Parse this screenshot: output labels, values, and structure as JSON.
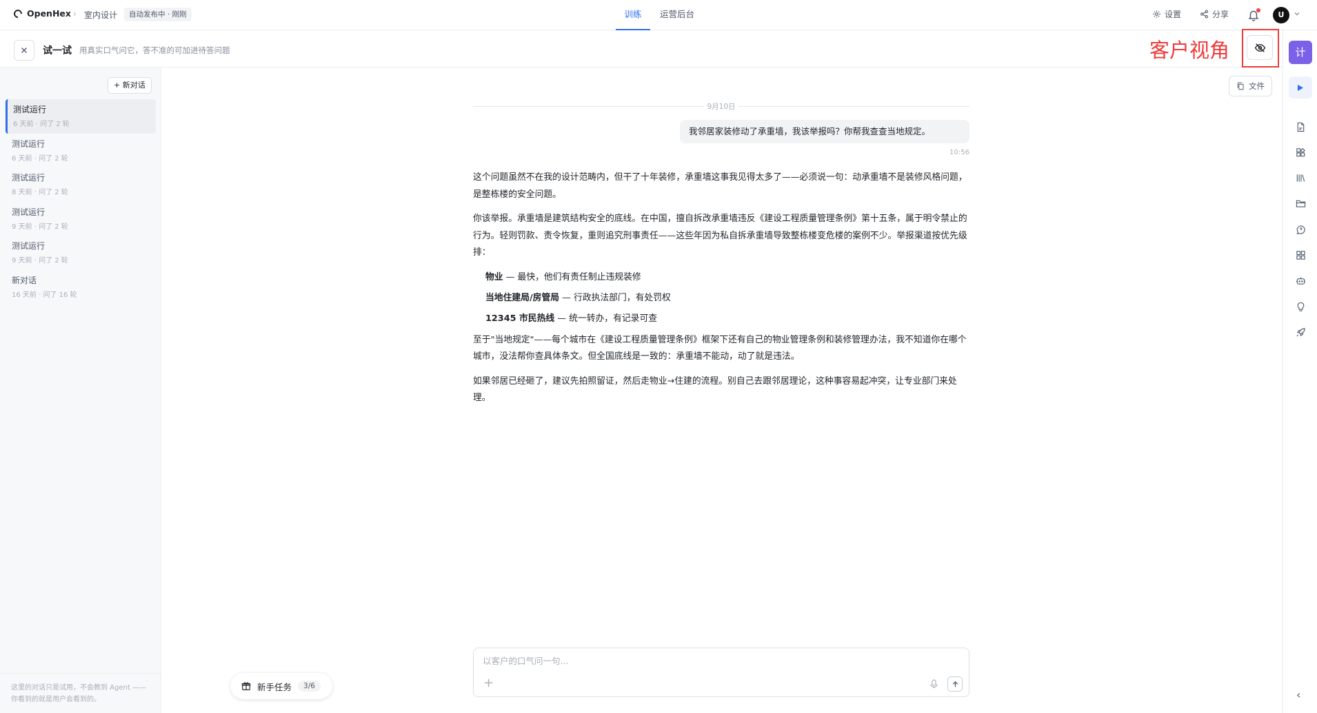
{
  "topbar": {
    "brand": "OpenHex",
    "breadcrumb_app": "室内设计",
    "status_badge": "自动发布中 · 刚刚",
    "tabs": [
      {
        "label": "训练",
        "active": true
      },
      {
        "label": "运营后台",
        "active": false
      }
    ],
    "settings_label": "设置",
    "share_label": "分享",
    "avatar_initial": "U"
  },
  "subbar": {
    "title": "试一试",
    "subtitle": "用真实口气问它，答不准的可加进待答问题",
    "customer_view_label": "客户视角"
  },
  "sidebar": {
    "new_chat_label": "+ 新对话",
    "conversations": [
      {
        "title": "测试运行",
        "meta": "6 天前 · 问了 2 轮",
        "active": true
      },
      {
        "title": "测试运行",
        "meta": "6 天前 · 问了 2 轮",
        "active": false
      },
      {
        "title": "测试运行",
        "meta": "8 天前 · 问了 2 轮",
        "active": false
      },
      {
        "title": "测试运行",
        "meta": "9 天前 · 问了 2 轮",
        "active": false
      },
      {
        "title": "测试运行",
        "meta": "9 天前 · 问了 2 轮",
        "active": false
      },
      {
        "title": "新对话",
        "meta": "16 天前 · 问了 16 轮",
        "active": false
      }
    ],
    "footer_note": "这里的对话只是试用，不会教到 Agent —— 你看到的就是用户会看到的。"
  },
  "chat": {
    "file_button_label": "文件",
    "date_divider": "9月10日",
    "user_message": "我邻居家装修动了承重墙，我该举报吗？你帮我查查当地规定。",
    "user_message_time": "10:56",
    "reply": {
      "p1": "这个问题虽然不在我的设计范畴内，但干了十年装修，承重墙这事我见得太多了——必须说一句：动承重墙不是装修风格问题，是整栋楼的安全问题。",
      "p2": "你该举报。承重墙是建筑结构安全的底线。在中国，擅自拆改承重墙违反《建设工程质量管理条例》第十五条，属于明令禁止的行为。轻则罚款、责令恢复，重则追究刑事责任——这些年因为私自拆承重墙导致整栋楼变危楼的案例不少。举报渠道按优先级排：",
      "channels": [
        {
          "name": "物业",
          "desc": " — 最快，他们有责任制止违规装修"
        },
        {
          "name": "当地住建局/房管局",
          "desc": " — 行政执法部门，有处罚权"
        },
        {
          "name": "12345 市民热线",
          "desc": " — 统一转办，有记录可查"
        }
      ],
      "p3": "至于\"当地规定\"——每个城市在《建设工程质量管理条例》框架下还有自己的物业管理条例和装修管理办法，我不知道你在哪个城市，没法帮你查具体条文。但全国底线是一致的：承重墙不能动，动了就是违法。",
      "p4": "如果邻居已经砸了，建议先拍照留证，然后走物业→住建的流程。别自己去跟邻居理论，这种事容易起冲突，让专业部门来处理。"
    },
    "composer_placeholder": "以客户的口气问一句..."
  },
  "task_pill": {
    "label": "新手任务",
    "count": "3/6"
  },
  "right_rail": {
    "calc_label": "计",
    "icons": [
      "pdf-icon",
      "widgets-icon",
      "library-icon",
      "folder-icon",
      "chat-bubble-icon",
      "grid-icon",
      "bot-icon",
      "bulb-icon",
      "rocket-icon"
    ]
  },
  "colors": {
    "accent": "#2f6fe8",
    "annotation_red": "#ee3a3a",
    "rail_purple": "#7b61e8",
    "notification_dot": "#f53f3f"
  }
}
